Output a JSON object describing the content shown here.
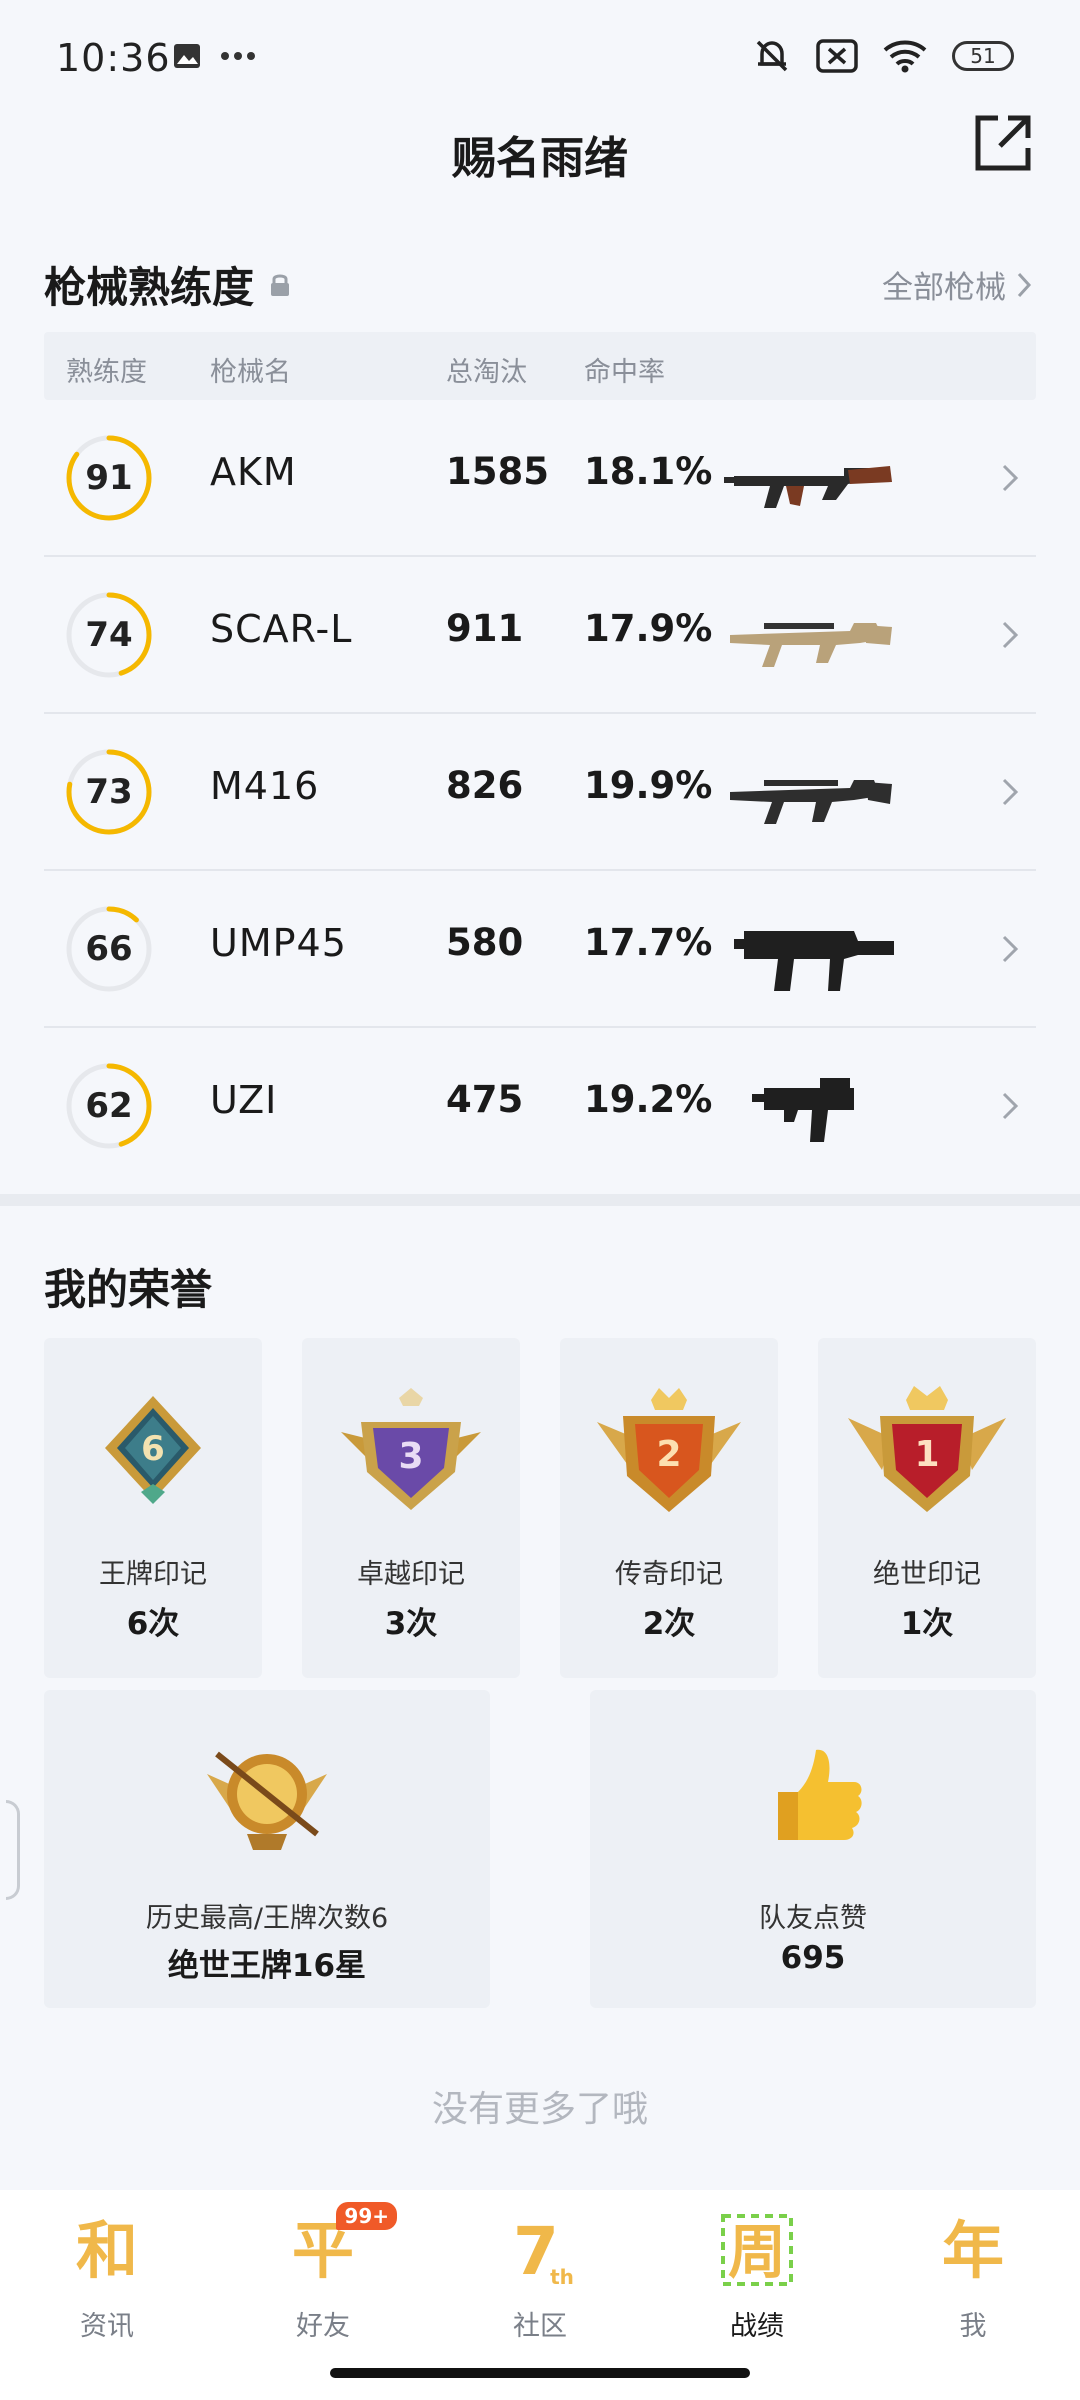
{
  "status_bar": {
    "time": "10:36",
    "battery": "51"
  },
  "header": {
    "title": "赐名雨绪"
  },
  "gun_section": {
    "title": "枪械熟练度",
    "all_link": "全部枪械",
    "columns": [
      "熟练度",
      "枪械名",
      "总淘汰",
      "命中率"
    ],
    "rows": [
      {
        "level": "91",
        "progress": 0.85,
        "name": "AKM",
        "kills": "1585",
        "rate": "18.1%",
        "icon": "rifle-akm-icon"
      },
      {
        "level": "74",
        "progress": 0.45,
        "name": "SCAR-L",
        "kills": "911",
        "rate": "17.9%",
        "icon": "rifle-scar-icon"
      },
      {
        "level": "73",
        "progress": 0.78,
        "name": "M416",
        "kills": "826",
        "rate": "19.9%",
        "icon": "rifle-m416-icon"
      },
      {
        "level": "66",
        "progress": 0.12,
        "name": "UMP45",
        "kills": "580",
        "rate": "17.7%",
        "icon": "smg-ump-icon"
      },
      {
        "level": "62",
        "progress": 0.45,
        "name": "UZI",
        "kills": "475",
        "rate": "19.2%",
        "icon": "smg-uzi-icon"
      }
    ]
  },
  "honor_section": {
    "title": "我的荣誉",
    "badges": [
      {
        "label": "王牌印记",
        "count": "6次",
        "digit": "6"
      },
      {
        "label": "卓越印记",
        "count": "3次",
        "digit": "3"
      },
      {
        "label": "传奇印记",
        "count": "2次",
        "digit": "2"
      },
      {
        "label": "绝世印记",
        "count": "1次",
        "digit": "1"
      }
    ],
    "best": {
      "label": "历史最高/王牌次数6",
      "value": "绝世王牌16星"
    },
    "likes": {
      "label": "队友点赞",
      "value": "695"
    }
  },
  "footer_note": "没有更多了哦",
  "tabs": [
    {
      "glyph": "和",
      "label": "资讯",
      "active": false
    },
    {
      "glyph": "平",
      "label": "好友",
      "active": false,
      "badge": "99+"
    },
    {
      "glyph": "7",
      "label": "社区",
      "active": false
    },
    {
      "glyph": "周",
      "label": "战绩",
      "active": true
    },
    {
      "glyph": "年",
      "label": "我",
      "active": false
    }
  ],
  "colors": {
    "accent": "#f5b800",
    "tab_glyph": "#f0b84a",
    "bg": "#f5f7fb"
  }
}
